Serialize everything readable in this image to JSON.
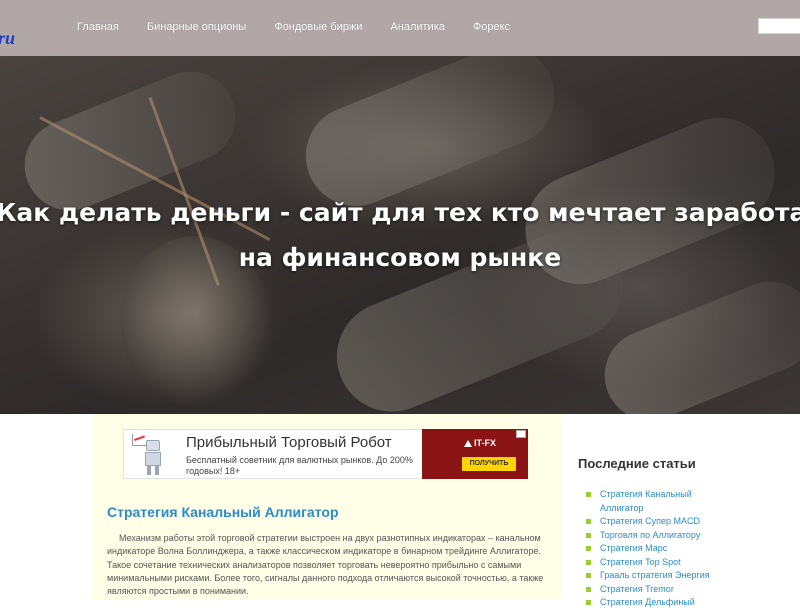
{
  "header": {
    "logo_text": "ru",
    "nav": [
      "Главная",
      "Бинарные опционы",
      "Фондовые биржи",
      "Аналитика",
      "Форекс"
    ],
    "search_value": ""
  },
  "hero": {
    "title_line1": "Как делать деньги - сайт для тех кто мечтает заработать",
    "title_line2": "на финансовом рынке"
  },
  "ad": {
    "title": "Прибыльный Торговый Робот",
    "text": "Бесплатный советник для валютных рынков. До 200% годовых! 18+",
    "brand": "IT-FX",
    "cta": "ПОЛУЧИТЬ"
  },
  "article": {
    "title": "Стратегия Канальный Аллигатор",
    "text": "Механизм работы этой торговой стратегии выстроен на двух разнотипных индикаторах – канальном индикаторе Волна Боллинджера, а также классическом индикаторе в бинарном трейдинге Аллигаторе. Такое сочетание технических анализаторов позволяет торговать невероятно прибыльно с самыми минимальными рисками. Более того, сигналы данного подхода отличаются высокой точностью, а также являются простыми в понимании."
  },
  "sidebar": {
    "heading": "Последние статьи",
    "items": [
      "Стратегия Канальный Аллигатор",
      "Стратегия Супер MACD",
      "Торговля по Аллигатору",
      "Стратегия Марс",
      "Стратегия Top Spot",
      "Грааль стратегия Энергия",
      "Стратегия Tremor",
      "Стратегия Дельфиный"
    ]
  },
  "colors": {
    "topbar": "#b1a7a7",
    "link": "#2a8ccf",
    "content_bg": "#fffee6",
    "ad_brand": "#8a1414",
    "cta": "#ffd400",
    "bullet": "#9acd32"
  }
}
